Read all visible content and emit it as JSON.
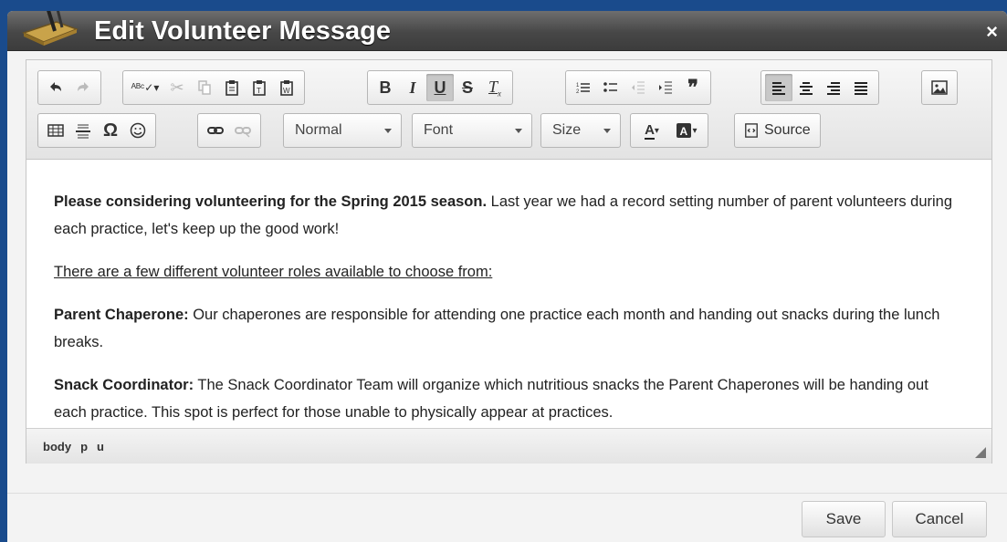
{
  "dialog": {
    "title": "Edit Volunteer Message",
    "close_label": "×"
  },
  "toolbar": {
    "format_select": "Normal",
    "font_select": "Font",
    "size_select": "Size",
    "text_color_label": "A",
    "source_label": "Source"
  },
  "content": {
    "p1_bold": "Please considering volunteering for the Spring 2015 season.",
    "p1_rest": " Last year we had a record setting number of parent volunteers during each practice, let's keep up the good work!",
    "p2_underline": "There are a few different volunteer roles available to choose from:",
    "p3_bold": "Parent Chaperone:",
    "p3_rest": " Our chaperones are responsible for attending one practice each month and handing out snacks during the lunch breaks.",
    "p4_bold": "Snack Coordinator:",
    "p4_rest": " The Snack Coordinator Team will organize which nutritious snacks the Parent Chaperones will be handing out each practice. This spot is perfect for those unable to physically appear at practices."
  },
  "statusbar": {
    "path": [
      "body",
      "p",
      "u"
    ]
  },
  "footer": {
    "save_label": "Save",
    "cancel_label": "Cancel"
  }
}
